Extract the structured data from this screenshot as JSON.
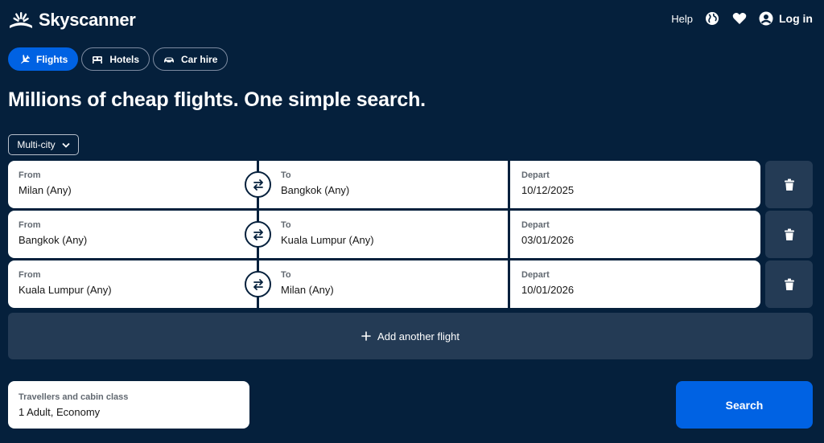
{
  "header": {
    "brand": "Skyscanner",
    "help_label": "Help",
    "login_label": "Log in"
  },
  "tabs": [
    {
      "label": "Flights",
      "icon": "plane-icon",
      "active": true
    },
    {
      "label": "Hotels",
      "icon": "bed-icon",
      "active": false
    },
    {
      "label": "Car hire",
      "icon": "car-icon",
      "active": false
    }
  ],
  "headline": "Millions of cheap flights. One simple search.",
  "trip_type": "Multi-city",
  "legs": [
    {
      "from_label": "From",
      "from": "Milan (Any)",
      "to_label": "To",
      "to": "Bangkok (Any)",
      "depart_label": "Depart",
      "depart": "10/12/2025"
    },
    {
      "from_label": "From",
      "from": "Bangkok (Any)",
      "to_label": "To",
      "to": "Kuala Lumpur (Any)",
      "depart_label": "Depart",
      "depart": "03/01/2026"
    },
    {
      "from_label": "From",
      "from": "Kuala Lumpur (Any)",
      "to_label": "To",
      "to": "Milan (Any)",
      "depart_label": "Depart",
      "depart": "10/01/2026"
    }
  ],
  "add_flight_label": "Add another flight",
  "travellers": {
    "label": "Travellers and cabin class",
    "value": "1 Adult, Economy"
  },
  "search_label": "Search",
  "colors": {
    "background": "#05203c",
    "accent": "#0062e3",
    "secondary_surface": "#243b55"
  }
}
